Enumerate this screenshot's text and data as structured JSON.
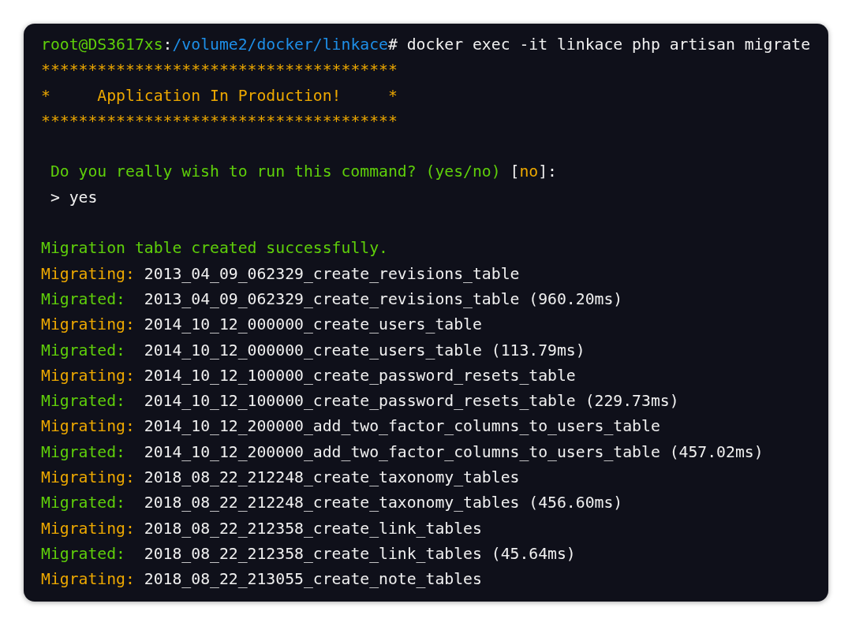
{
  "terminal": {
    "blocks": [
      {
        "lines": [
          {
            "kind": "output",
            "segments": [
              {
                "kind": "info",
                "text": "root@DS3617xs"
              },
              {
                "kind": "plain",
                "text": ":"
              },
              {
                "kind": "path",
                "text": "/volume2/docker/linkace"
              },
              {
                "kind": "plain",
                "text": "# docker exec -it linkace php artisan migrate"
              }
            ]
          },
          {
            "kind": "output",
            "segments": [
              {
                "kind": "comment",
                "text": "**************************************"
              }
            ]
          },
          {
            "kind": "output",
            "segments": [
              {
                "kind": "comment",
                "text": "*     Application In Production!     *"
              }
            ]
          },
          {
            "kind": "output",
            "segments": [
              {
                "kind": "comment",
                "text": "**************************************"
              }
            ]
          }
        ]
      },
      {
        "lines": [
          {
            "kind": "dialog",
            "segments": [
              {
                "kind": "info",
                "text": "Do you really wish to run this command? (yes/no)"
              },
              {
                "kind": "plain",
                "text": " ["
              },
              {
                "kind": "comment",
                "text": "no"
              },
              {
                "kind": "plain",
                "text": "]:"
              }
            ]
          },
          {
            "kind": "dialog",
            "segments": [
              {
                "kind": "plain",
                "text": "> yes"
              }
            ]
          }
        ]
      },
      {
        "lines": [
          {
            "kind": "output",
            "segments": [
              {
                "kind": "info",
                "text": "Migration table created successfully."
              }
            ]
          },
          {
            "kind": "output",
            "segments": [
              {
                "kind": "comment",
                "text": "Migrating:"
              },
              {
                "kind": "plain",
                "text": " 2013_04_09_062329_create_revisions_table"
              }
            ]
          },
          {
            "kind": "output",
            "segments": [
              {
                "kind": "info",
                "text": "Migrated:"
              },
              {
                "kind": "plain",
                "text": "  2013_04_09_062329_create_revisions_table (960.20ms)"
              }
            ]
          },
          {
            "kind": "output",
            "segments": [
              {
                "kind": "comment",
                "text": "Migrating:"
              },
              {
                "kind": "plain",
                "text": " 2014_10_12_000000_create_users_table"
              }
            ]
          },
          {
            "kind": "output",
            "segments": [
              {
                "kind": "info",
                "text": "Migrated:"
              },
              {
                "kind": "plain",
                "text": "  2014_10_12_000000_create_users_table (113.79ms)"
              }
            ]
          },
          {
            "kind": "output",
            "segments": [
              {
                "kind": "comment",
                "text": "Migrating:"
              },
              {
                "kind": "plain",
                "text": " 2014_10_12_100000_create_password_resets_table"
              }
            ]
          },
          {
            "kind": "output",
            "segments": [
              {
                "kind": "info",
                "text": "Migrated:"
              },
              {
                "kind": "plain",
                "text": "  2014_10_12_100000_create_password_resets_table (229.73ms)"
              }
            ]
          },
          {
            "kind": "output",
            "segments": [
              {
                "kind": "comment",
                "text": "Migrating:"
              },
              {
                "kind": "plain",
                "text": " 2014_10_12_200000_add_two_factor_columns_to_users_table"
              }
            ]
          },
          {
            "kind": "output",
            "segments": [
              {
                "kind": "info",
                "text": "Migrated:"
              },
              {
                "kind": "plain",
                "text": "  2014_10_12_200000_add_two_factor_columns_to_users_table (457.02ms)"
              }
            ]
          },
          {
            "kind": "output",
            "segments": [
              {
                "kind": "comment",
                "text": "Migrating:"
              },
              {
                "kind": "plain",
                "text": " 2018_08_22_212248_create_taxonomy_tables"
              }
            ]
          },
          {
            "kind": "output",
            "segments": [
              {
                "kind": "info",
                "text": "Migrated:"
              },
              {
                "kind": "plain",
                "text": "  2018_08_22_212248_create_taxonomy_tables (456.60ms)"
              }
            ]
          },
          {
            "kind": "output",
            "segments": [
              {
                "kind": "comment",
                "text": "Migrating:"
              },
              {
                "kind": "plain",
                "text": " 2018_08_22_212358_create_link_tables"
              }
            ]
          },
          {
            "kind": "output",
            "segments": [
              {
                "kind": "info",
                "text": "Migrated:"
              },
              {
                "kind": "plain",
                "text": "  2018_08_22_212358_create_link_tables (45.64ms)"
              }
            ]
          },
          {
            "kind": "output",
            "segments": [
              {
                "kind": "comment",
                "text": "Migrating:"
              },
              {
                "kind": "plain",
                "text": " 2018_08_22_213055_create_note_tables"
              }
            ]
          }
        ]
      }
    ]
  }
}
